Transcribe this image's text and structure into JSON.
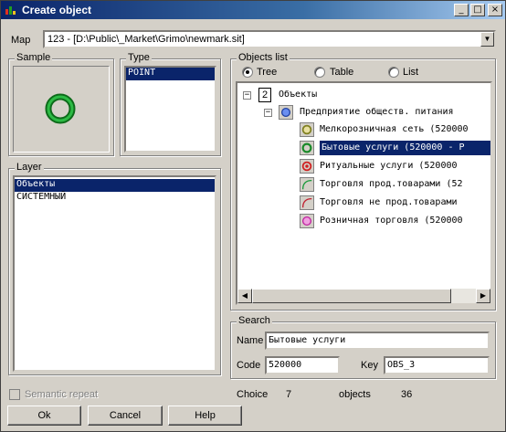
{
  "window": {
    "title": "Create object"
  },
  "map": {
    "label": "Map",
    "value": "123 - [D:\\Public\\_Market\\Grimo\\newmark.sit]"
  },
  "sample": {
    "label": "Sample"
  },
  "type": {
    "label": "Type",
    "items": [
      "POINT"
    ]
  },
  "layer": {
    "label": "Layer",
    "items": [
      "Объекты",
      "СИСТЕМНЫЙ"
    ]
  },
  "objects_list": {
    "label": "Objects list",
    "view_modes": [
      "Tree",
      "Table",
      "List"
    ],
    "selected_mode": "Tree",
    "tree": {
      "root_badge": "2",
      "root_label": "Объекты",
      "group_label": "Предприятие обществ. питания",
      "items": [
        "Мелкорозничная сеть (520000",
        "Бытовые услуги (520000 - Р",
        "Ритуальные услуги (520000",
        "Торговля прод.товарами (52",
        "Торговля не прод.товарами",
        "Розничная торговля (520000"
      ]
    }
  },
  "search": {
    "label": "Search",
    "name_label": "Name",
    "name_value": "Бытовые услуги",
    "code_label": "Code",
    "code_value": "520000",
    "key_label": "Key",
    "key_value": "OBS_3"
  },
  "semantic_repeat": {
    "label": "Semantic repeat"
  },
  "status": {
    "choice_label": "Choice",
    "choice_value": "7",
    "objects_label": "objects",
    "objects_value": "36"
  },
  "buttons": {
    "ok": "Ok",
    "cancel": "Cancel",
    "help": "Help"
  },
  "colors": {
    "title_blue": "#0a246a",
    "selection": "#0a246a",
    "sample_ring": "#1a8a2a"
  }
}
